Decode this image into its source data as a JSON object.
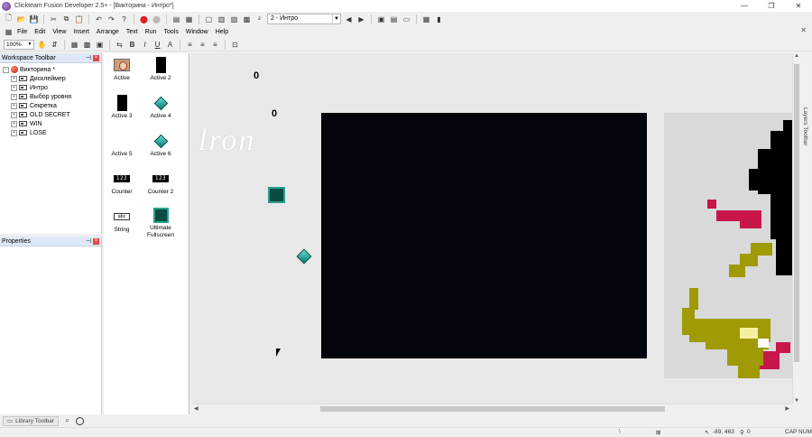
{
  "window": {
    "title": "Clickteam Fusion Developer 2.5+ - [Викторина - Интро*]",
    "minimize": "—",
    "maximize": "❐",
    "close": "✕"
  },
  "toolbar": {
    "frame_select": "2 - Интро"
  },
  "menu": {
    "items": [
      "File",
      "Edit",
      "View",
      "Insert",
      "Arrange",
      "Text",
      "Run",
      "Tools",
      "Window",
      "Help"
    ],
    "doc_close": "✕"
  },
  "format_toolbar": {
    "zoom": "100%",
    "bold": "B",
    "italic": "I",
    "underline": "U"
  },
  "workspace": {
    "title": "Workspace Toolbar",
    "root": "Викторина *",
    "frames": [
      "Дисклеймер",
      "Интро",
      "Выбор уровня",
      "Секретка",
      "OLD SECRET",
      "WIN",
      "LOSE"
    ]
  },
  "properties": {
    "title": "Properties"
  },
  "objects": [
    {
      "label": "Active",
      "icon": "photo-icon"
    },
    {
      "label": "Active 2",
      "icon": "black-rect-icon"
    },
    {
      "label": "Active 3",
      "icon": "black-rect-icon"
    },
    {
      "label": "Active 4",
      "icon": "diamond-icon"
    },
    {
      "label": "Active 5",
      "icon": "none"
    },
    {
      "label": "Active 6",
      "icon": "diamond-icon"
    },
    {
      "label": "Counter",
      "icon": "counter-icon"
    },
    {
      "label": "Counter 2",
      "icon": "counter-icon"
    },
    {
      "label": "String",
      "icon": "string-icon"
    },
    {
      "label": "Ultimate Fullscreen",
      "icon": "fullscreen-extension-icon"
    }
  ],
  "icon_text": {
    "counter": "123",
    "string": "abc"
  },
  "editor": {
    "counter1": "0",
    "counter2": "0",
    "iron_text": "lron"
  },
  "layers_tab": "Layers Toolbar",
  "bottom": {
    "library_tab": "Library Toolbar"
  },
  "status": {
    "coords": "-89, 463",
    "zero": "0",
    "caps": "CAP NUM"
  },
  "colors": {
    "canvas": "#03050c",
    "pixel_black": "#000000",
    "pixel_red": "#c8164a",
    "pixel_olive": "#a09a06",
    "pixel_yellow": "#f4f0a0",
    "diamond": "#18948a"
  }
}
